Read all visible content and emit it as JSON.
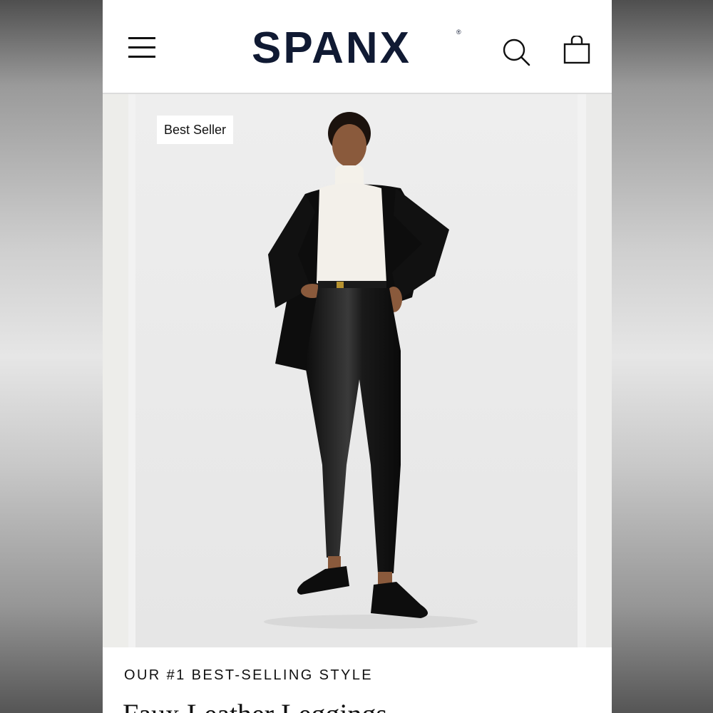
{
  "header": {
    "brand": "SPANX",
    "registered_mark": "®",
    "icons": [
      "menu-icon",
      "search-icon",
      "shopping-bag-icon"
    ]
  },
  "product_image": {
    "badge": "Best Seller"
  },
  "product": {
    "kicker": "OUR #1 BEST-SELLING STYLE",
    "title": "Faux Leather Leggings"
  },
  "colors": {
    "brand_navy": "#101a33",
    "image_background": "#ececec",
    "page_background": "#ffffff"
  }
}
